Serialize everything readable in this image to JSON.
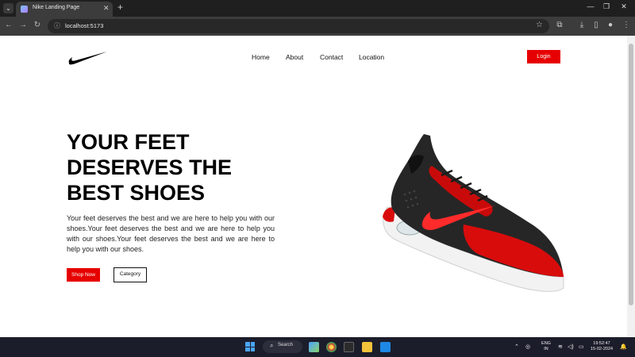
{
  "browser": {
    "tab_title": "Nike Landing Page",
    "url": "localhost:5173"
  },
  "page": {
    "nav": {
      "links": [
        "Home",
        "About",
        "Contact",
        "Location"
      ],
      "login_label": "Login"
    },
    "hero": {
      "title": "YOUR FEET DESERVES THE BEST SHOES",
      "description": "Your feet deserves the best and we are here to help you with our shoes.Your feet deserves the best and we are here to help you with our shoes.Your feet deserves the best and we are here to help you with our shoes.",
      "primary_button": "Shop Now",
      "secondary_button": "Category"
    },
    "accent_color": "#e60000"
  },
  "taskbar": {
    "search_label": "Search",
    "lang_line1": "ENG",
    "lang_line2": "IN",
    "time": "19:52:47",
    "date": "15-02-2024"
  }
}
